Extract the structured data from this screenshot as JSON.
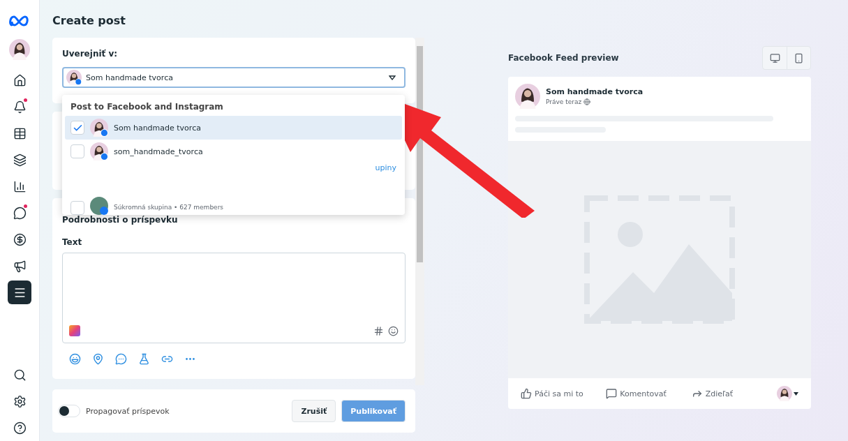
{
  "header": {
    "title": "Create post"
  },
  "sidebar": {
    "items": [
      {
        "kind": "home",
        "selected": false,
        "badge": false
      },
      {
        "kind": "bell",
        "selected": false,
        "badge": true
      },
      {
        "kind": "grid",
        "selected": false,
        "badge": false
      },
      {
        "kind": "pages",
        "selected": false,
        "badge": false
      },
      {
        "kind": "chart",
        "selected": false,
        "badge": false
      },
      {
        "kind": "chat",
        "selected": false,
        "badge": true
      },
      {
        "kind": "dollar",
        "selected": false,
        "badge": false
      },
      {
        "kind": "megaphone",
        "selected": false,
        "badge": false
      },
      {
        "kind": "menu",
        "selected": true,
        "badge": false
      }
    ],
    "bottom": [
      {
        "kind": "search"
      },
      {
        "kind": "settings"
      },
      {
        "kind": "help"
      }
    ]
  },
  "publish": {
    "label": "Uverejniť v:",
    "value": "Som handmade tvorca",
    "dropdown": {
      "heading": "Post to Facebook and Instagram",
      "options": [
        {
          "name": "Som handmade tvorca",
          "checked": true
        },
        {
          "name": "som_handmade_tvorca",
          "checked": false
        }
      ],
      "link": "upiny",
      "group": {
        "subtitle": "Súkromná skupina • 627 members",
        "checked": false
      }
    }
  },
  "details": {
    "heading": "Podrobnosti o príspevku",
    "text_label": "Text"
  },
  "footer": {
    "promote": {
      "label": "Propagovať príspevok",
      "on": false
    },
    "cancel": "Zrušiť",
    "publish": {
      "label": "Publikovať",
      "disabled": true
    }
  },
  "preview": {
    "title": "Facebook Feed preview",
    "author": "Som handmade tvorca",
    "time": "Práve teraz",
    "actions": [
      {
        "kind": "like",
        "label": "Páči sa mi to"
      },
      {
        "kind": "comment",
        "label": "Komentovať"
      },
      {
        "kind": "share",
        "label": "Zdieľať"
      }
    ]
  }
}
